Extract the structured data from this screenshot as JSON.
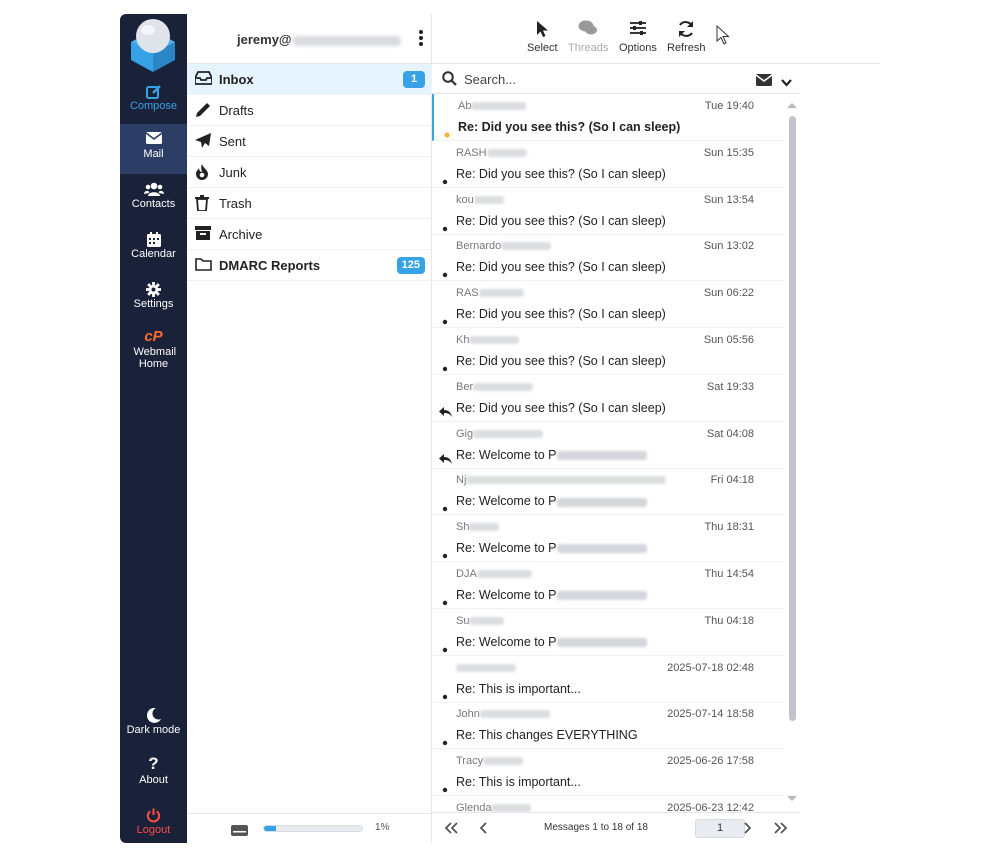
{
  "nav": {
    "items": [
      {
        "label": "Compose",
        "icon": "compose-icon"
      },
      {
        "label": "Mail",
        "icon": "envelope-icon"
      },
      {
        "label": "Contacts",
        "icon": "users-icon"
      },
      {
        "label": "Calendar",
        "icon": "calendar-icon"
      },
      {
        "label": "Settings",
        "icon": "gear-icon"
      },
      {
        "label": "Webmail Home",
        "icon": "cpanel-icon"
      }
    ],
    "bottom": [
      {
        "label": "Dark mode",
        "icon": "moon-icon"
      },
      {
        "label": "About",
        "icon": "question-icon"
      },
      {
        "label": "Logout",
        "icon": "power-icon"
      }
    ]
  },
  "account": {
    "name": "jeremy@"
  },
  "folders": [
    {
      "label": "Inbox",
      "badge": "1",
      "icon": "inbox-icon"
    },
    {
      "label": "Drafts",
      "badge": "",
      "icon": "pencil-icon"
    },
    {
      "label": "Sent",
      "badge": "",
      "icon": "paper-plane-icon"
    },
    {
      "label": "Junk",
      "badge": "",
      "icon": "fire-icon"
    },
    {
      "label": "Trash",
      "badge": "",
      "icon": "trash-icon"
    },
    {
      "label": "Archive",
      "badge": "",
      "icon": "archive-icon"
    },
    {
      "label": "DMARC Reports",
      "badge": "125",
      "icon": "folder-icon"
    }
  ],
  "quota": {
    "percent_label": "1%",
    "fill_fraction": 0.12
  },
  "toolbar": {
    "select": "Select",
    "threads": "Threads",
    "options": "Options",
    "refresh": "Refresh"
  },
  "search": {
    "placeholder": "Search..."
  },
  "messages": [
    {
      "from": "Ab",
      "date": "Tue 19:40",
      "subject": "Re: Did you see this? (So I can sleep)",
      "status": "unread"
    },
    {
      "from": "RASH",
      "date": "Sun 15:35",
      "subject": "Re: Did you see this? (So I can sleep)",
      "status": "dot"
    },
    {
      "from": "kou",
      "date": "Sun 13:54",
      "subject": "Re: Did you see this? (So I can sleep)",
      "status": "dot"
    },
    {
      "from": "Bernardo",
      "date": "Sun 13:02",
      "subject": "Re: Did you see this? (So I can sleep)",
      "status": "dot"
    },
    {
      "from": "RAS",
      "date": "Sun 06:22",
      "subject": "Re: Did you see this? (So I can sleep)",
      "status": "dot"
    },
    {
      "from": "Kh",
      "date": "Sun 05:56",
      "subject": "Re: Did you see this? (So I can sleep)",
      "status": "dot"
    },
    {
      "from": "Ber",
      "date": "Sat 19:33",
      "subject": "Re: Did you see this? (So I can sleep)",
      "status": "replied"
    },
    {
      "from": "Gig",
      "date": "Sat 04:08",
      "subject": "Re: Welcome to P",
      "status": "replied"
    },
    {
      "from": "Nj",
      "date": "Fri 04:18",
      "subject": "Re: Welcome to P",
      "status": "dot"
    },
    {
      "from": "Sh",
      "date": "Thu 18:31",
      "subject": "Re: Welcome to P",
      "status": "dot"
    },
    {
      "from": "DJA",
      "date": "Thu 14:54",
      "subject": "Re: Welcome to P",
      "status": "dot"
    },
    {
      "from": "Su",
      "date": "Thu 04:18",
      "subject": "Re: Welcome to P",
      "status": "dot"
    },
    {
      "from": "",
      "date": "2025-07-18 02:48",
      "subject": "Re: This is important...",
      "status": "dot"
    },
    {
      "from": "John",
      "date": "2025-07-14 18:58",
      "subject": "Re: This changes EVERYTHING",
      "status": "dot"
    },
    {
      "from": "Tracy",
      "date": "2025-06-26 17:58",
      "subject": "Re: This is important...",
      "status": "dot"
    },
    {
      "from": "Glenda",
      "date": "2025-06-23 12:42",
      "subject": "",
      "status": "dot"
    }
  ],
  "pager": {
    "text": "Messages 1 to 18 of 18",
    "page": "1"
  },
  "colors": {
    "nav_bg": "#1a2239",
    "accent": "#37a3e6",
    "logout": "#ff4b4b",
    "unread_dot": "#f5b82e"
  }
}
